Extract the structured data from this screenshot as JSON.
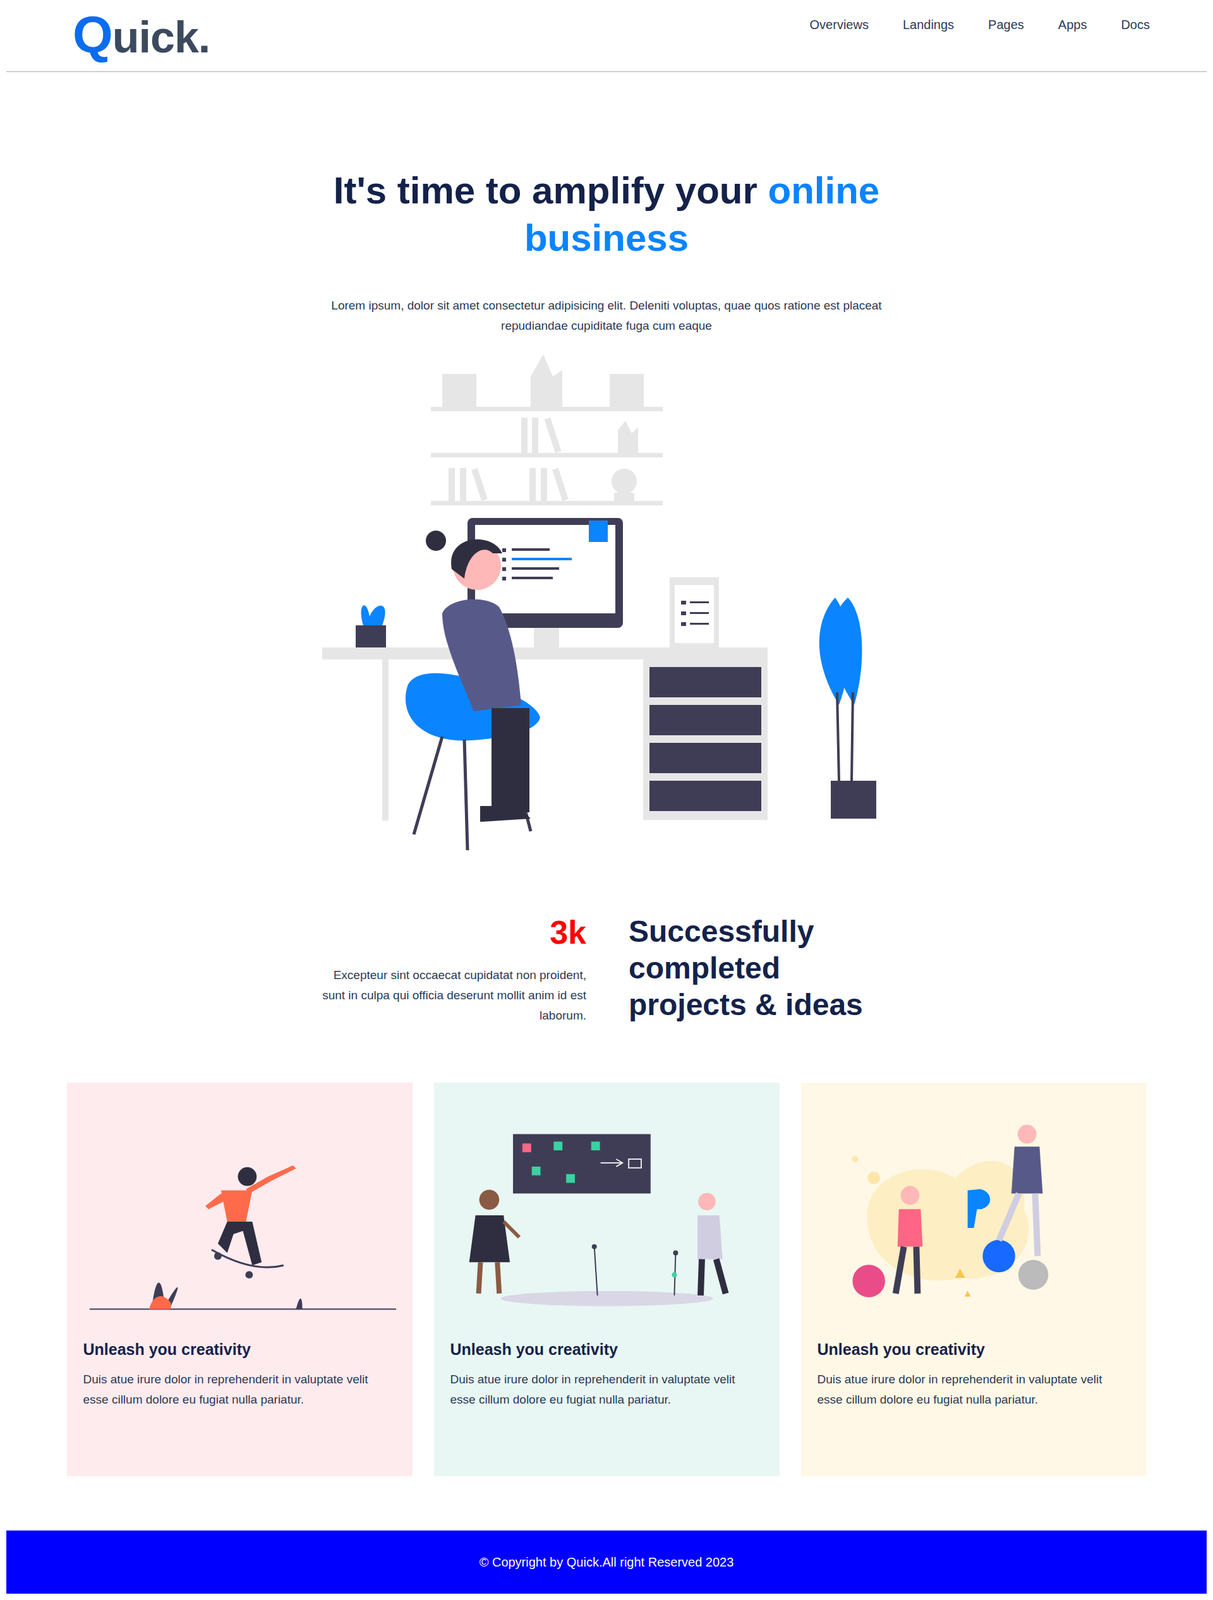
{
  "logo": {
    "mark": "Q",
    "rest": "uick."
  },
  "nav": [
    "Overviews",
    "Landings",
    "Pages",
    "Apps",
    "Docs"
  ],
  "hero": {
    "title": "It's time to amplify your ",
    "highlight": "online business",
    "subtitle": "Lorem ipsum, dolor sit amet consectetur adipisicing elit. Deleniti voluptas, quae quos ratione est placeat repudiandae cupiditate fuga cum eaque"
  },
  "stats": {
    "number": "3k",
    "text": "Excepteur sint occaecat cupidatat non proident, sunt in culpa qui officia deserunt mollit anim id est laborum.",
    "heading": "Successfully completed projects & ideas"
  },
  "cards": [
    {
      "title": "Unleash you creativity",
      "description": "Duis atue irure dolor in reprehenderit in valuptate velit esse cillum dolore eu fugiat nulla pariatur.",
      "color": "#fdebee"
    },
    {
      "title": "Unleash you creativity",
      "description": "Duis atue irure dolor in reprehenderit in valuptate velit esse cillum dolore eu fugiat nulla pariatur.",
      "color": "#e8f7f3"
    },
    {
      "title": "Unleash you creativity",
      "description": "Duis atue irure dolor in reprehenderit in valuptate velit esse cillum dolore eu fugiat nulla pariatur.",
      "color": "#fff8e6"
    }
  ],
  "footer": "© Copyright by Quick.All right Reserved 2023"
}
